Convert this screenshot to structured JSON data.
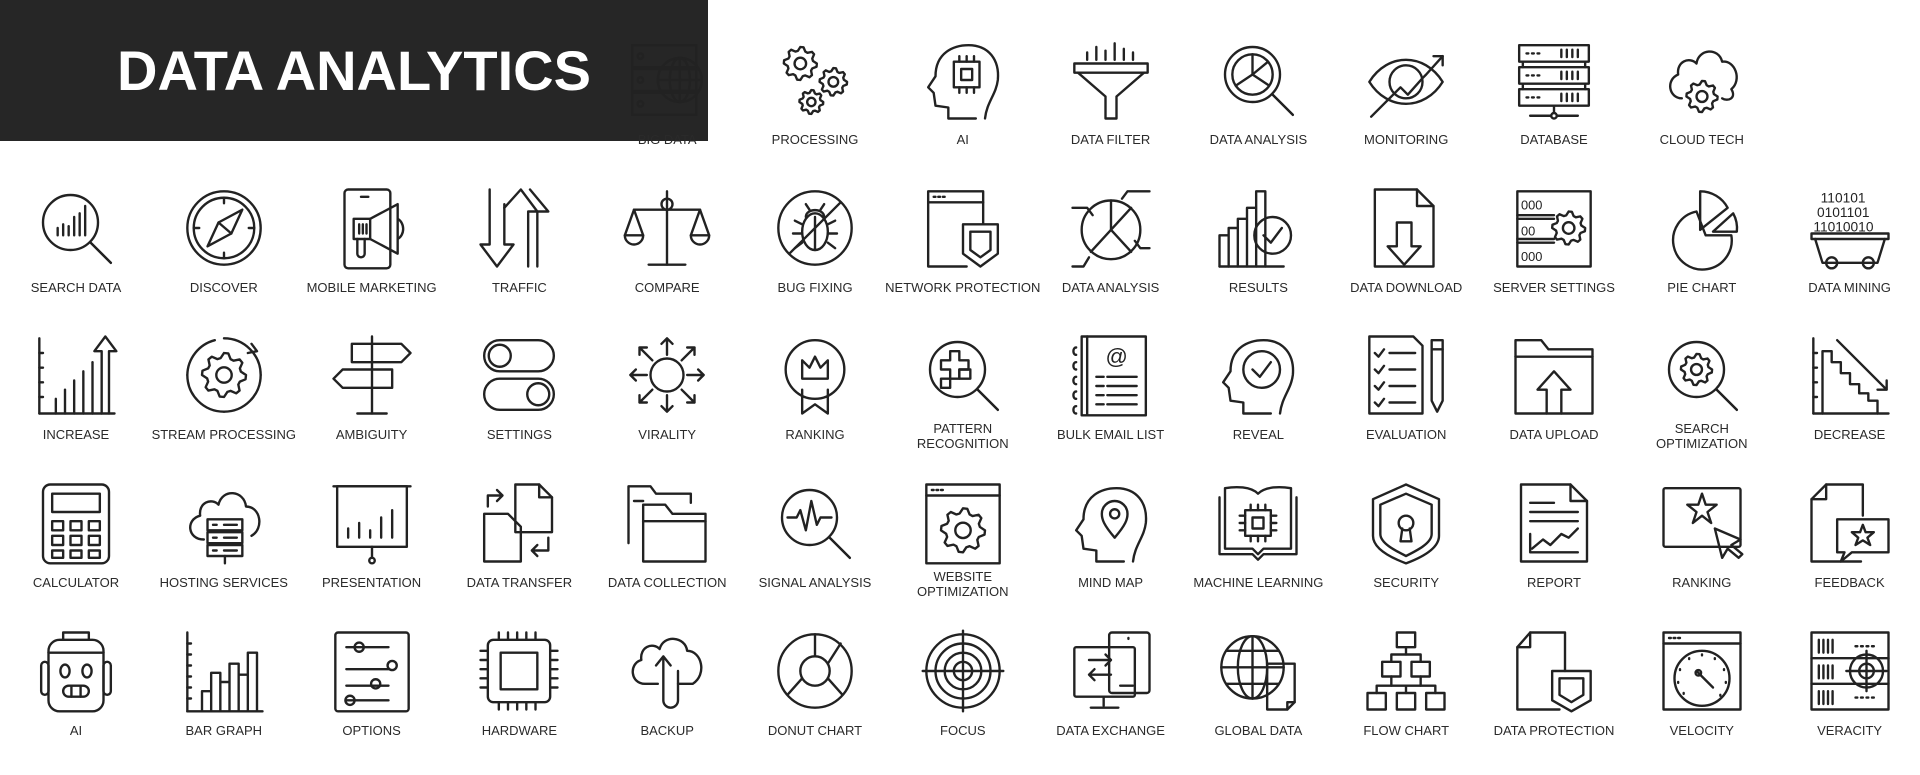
{
  "title": "DATA ANALYTICS",
  "rows": [
    [
      {
        "label": "Big Data",
        "icon": "big-data"
      },
      {
        "label": "Processing",
        "icon": "gears"
      },
      {
        "label": "AI",
        "icon": "ai-head"
      },
      {
        "label": "Data Filter",
        "icon": "funnel"
      },
      {
        "label": "Data Analysis",
        "icon": "magnifier-pie"
      },
      {
        "label": "Monitoring",
        "icon": "eye-chart"
      },
      {
        "label": "Database",
        "icon": "server-stack"
      },
      {
        "label": "Cloud Tech",
        "icon": "cloud-gear"
      }
    ],
    [
      {
        "label": "Search Data",
        "icon": "magnifier-bars"
      },
      {
        "label": "Discover",
        "icon": "compass"
      },
      {
        "label": "Mobile Marketing",
        "icon": "phone-megaphone"
      },
      {
        "label": "Traffic",
        "icon": "up-down-arrows"
      },
      {
        "label": "Compare",
        "icon": "scales"
      },
      {
        "label": "Bug Fixing",
        "icon": "no-bug"
      },
      {
        "label": "Network Protection",
        "icon": "window-shield"
      },
      {
        "label": "Data Analysis",
        "icon": "pie-callouts"
      },
      {
        "label": "Results",
        "icon": "bars-check"
      },
      {
        "label": "Data Download",
        "icon": "file-download"
      },
      {
        "label": "Server Settings",
        "icon": "server-gear"
      },
      {
        "label": "Pie Chart",
        "icon": "pie-chart"
      },
      {
        "label": "Data Mining",
        "icon": "mine-cart"
      }
    ],
    [
      {
        "label": "Increase",
        "icon": "bars-increase"
      },
      {
        "label": "Stream Processing",
        "icon": "gear-cycle"
      },
      {
        "label": "Ambiguity",
        "icon": "signpost"
      },
      {
        "label": "Settings",
        "icon": "toggles"
      },
      {
        "label": "Virality",
        "icon": "sun-arrows"
      },
      {
        "label": "Ranking",
        "icon": "crown-badge"
      },
      {
        "label": "Pattern Recognition",
        "icon": "magnifier-pattern"
      },
      {
        "label": "Bulk Email List",
        "icon": "address-book"
      },
      {
        "label": "Reveal",
        "icon": "head-check"
      },
      {
        "label": "Evaluation",
        "icon": "checklist-pencil"
      },
      {
        "label": "Data Upload",
        "icon": "folder-upload"
      },
      {
        "label": "Search Optimization",
        "icon": "magnifier-gear"
      },
      {
        "label": "Decrease",
        "icon": "bars-decrease"
      }
    ],
    [
      {
        "label": "Calculator",
        "icon": "calculator"
      },
      {
        "label": "Hosting Services",
        "icon": "cloud-server"
      },
      {
        "label": "Presentation",
        "icon": "board-chart"
      },
      {
        "label": "Data Transfer",
        "icon": "files-transfer"
      },
      {
        "label": "Data Collection",
        "icon": "folders"
      },
      {
        "label": "Signal Analysis",
        "icon": "magnifier-pulse"
      },
      {
        "label": "Website Optimization",
        "icon": "window-gear"
      },
      {
        "label": "Mind Map",
        "icon": "head-pin"
      },
      {
        "label": "Machine Learning",
        "icon": "book-chip"
      },
      {
        "label": "Security",
        "icon": "shield-lock"
      },
      {
        "label": "Report",
        "icon": "document-chart"
      },
      {
        "label": "Ranking",
        "icon": "screen-star"
      },
      {
        "label": "Feedback",
        "icon": "file-star-bubble"
      }
    ],
    [
      {
        "label": "AI",
        "icon": "robot"
      },
      {
        "label": "Bar Graph",
        "icon": "bar-graph"
      },
      {
        "label": "Options",
        "icon": "sliders"
      },
      {
        "label": "Hardware",
        "icon": "chip"
      },
      {
        "label": "Backup",
        "icon": "cloud-backup"
      },
      {
        "label": "Donut Chart",
        "icon": "donut"
      },
      {
        "label": "Focus",
        "icon": "target"
      },
      {
        "label": "Data Exchange",
        "icon": "monitor-phone"
      },
      {
        "label": "Global Data",
        "icon": "globe-doc"
      },
      {
        "label": "Flow Chart",
        "icon": "flowchart"
      },
      {
        "label": "Data Protection",
        "icon": "file-shield"
      },
      {
        "label": "Velocity",
        "icon": "window-gauge"
      },
      {
        "label": "Veracity",
        "icon": "server-target"
      }
    ]
  ]
}
